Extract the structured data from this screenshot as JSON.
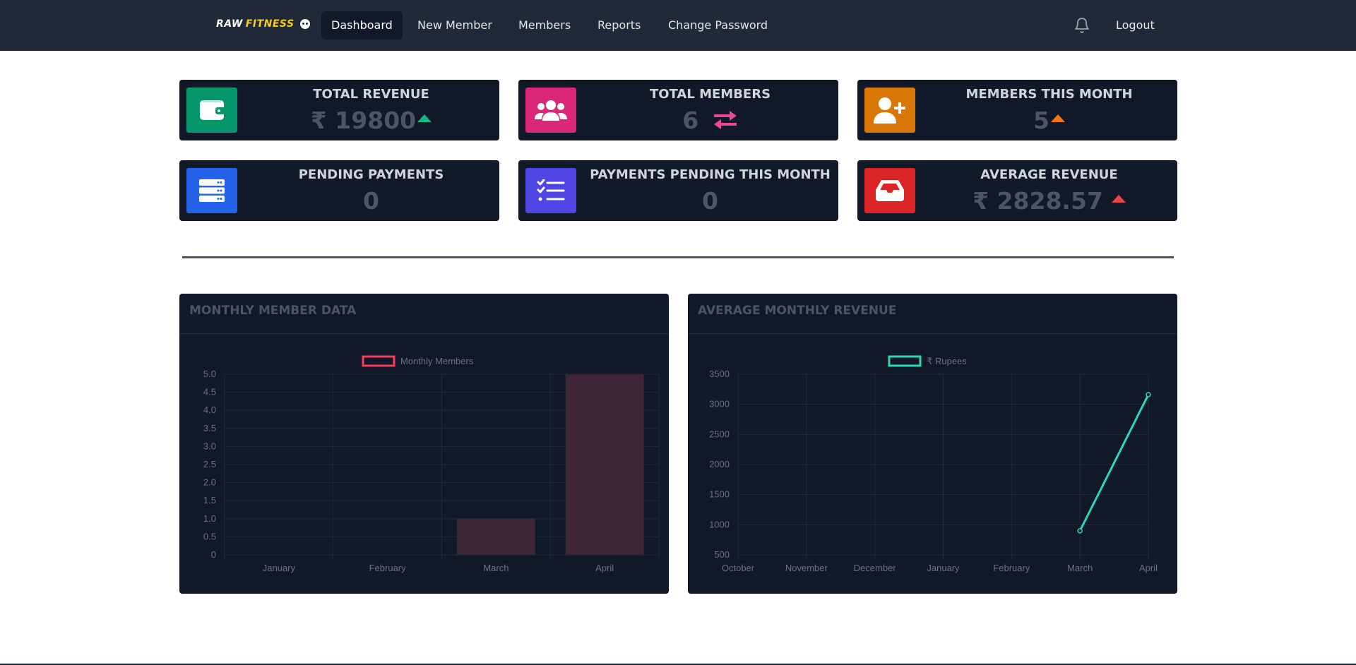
{
  "brand": {
    "part1": "RAW",
    "part2": "FITNESS"
  },
  "nav": {
    "items": [
      {
        "label": "Dashboard"
      },
      {
        "label": "New Member"
      },
      {
        "label": "Members"
      },
      {
        "label": "Reports"
      },
      {
        "label": "Change Password"
      }
    ],
    "logout": "Logout"
  },
  "cards": [
    {
      "label": "TOTAL REVENUE",
      "value": "₹ 19800",
      "color": "#059669",
      "icon": "wallet-icon",
      "trend": "up",
      "trend_color": "#10b981"
    },
    {
      "label": "TOTAL MEMBERS",
      "value": "6",
      "color": "#db2777",
      "icon": "users-icon",
      "trend": "swap",
      "trend_color": "#ec4899"
    },
    {
      "label": "MEMBERS THIS MONTH",
      "value": "5",
      "color": "#d97706",
      "icon": "user-plus-icon",
      "trend": "up",
      "trend_color": "#f97316"
    },
    {
      "label": "PENDING PAYMENTS",
      "value": "0",
      "color": "#2563eb",
      "icon": "server-icon",
      "trend": "none"
    },
    {
      "label": "PAYMENTS PENDING THIS MONTH",
      "value": "0",
      "color": "#4f46e5",
      "icon": "tasks-list-icon",
      "trend": "none"
    },
    {
      "label": "AVERAGE REVENUE",
      "value": "₹ 2828.57",
      "color": "#dc2626",
      "icon": "inbox-icon",
      "trend": "up",
      "trend_color": "#ef4444"
    }
  ],
  "chart_data": [
    {
      "title": "MONTHLY MEMBER DATA",
      "type": "bar",
      "categories": [
        "January",
        "February",
        "March",
        "April"
      ],
      "series": [
        {
          "name": "Monthly Members",
          "values": [
            0,
            0,
            1,
            5
          ]
        }
      ],
      "ylim": [
        0,
        5
      ],
      "yticks": [
        "0",
        "0.5",
        "1.0",
        "1.5",
        "2.0",
        "2.5",
        "3.0",
        "3.5",
        "4.0",
        "4.5",
        "5.0"
      ],
      "bar_color": "#3f2635",
      "legend_color": "#f43f5e",
      "legend_position": "top"
    },
    {
      "title": "AVERAGE MONTHLY REVENUE",
      "type": "line",
      "categories": [
        "October",
        "November",
        "December",
        "January",
        "February",
        "March",
        "April"
      ],
      "series": [
        {
          "name": "₹ Rupees",
          "values": [
            null,
            null,
            null,
            null,
            null,
            900,
            3160
          ]
        }
      ],
      "ylim": [
        500,
        3500
      ],
      "yticks": [
        "500",
        "1000",
        "1500",
        "2000",
        "2500",
        "3000",
        "3500"
      ],
      "line_color": "#2dd4bf",
      "legend_position": "top"
    }
  ]
}
